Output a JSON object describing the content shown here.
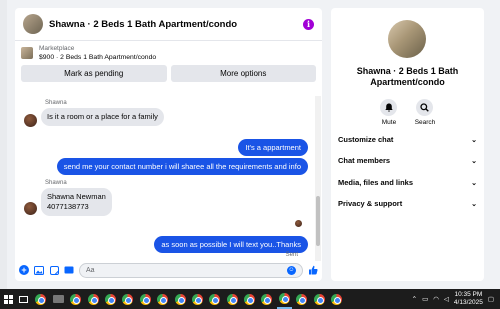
{
  "chat": {
    "title": "Shawna · 2 Beds 1 Bath Apartment/condo",
    "listing_label": "Marketplace",
    "listing_title": "$900 · 2 Beds 1 Bath Apartment/condo",
    "mark_pending": "Mark as pending",
    "more_options": "More options",
    "messages": [
      {
        "sender": "Shawna",
        "text": "Is it a room or a place for a family",
        "dir": "in"
      },
      {
        "text": "It's a appartment",
        "dir": "out"
      },
      {
        "text": "send me your contact number i will sharee  all the requirements and info",
        "dir": "out"
      },
      {
        "sender": "Shawna",
        "text": "Shawna Newman\n4077138773",
        "dir": "in"
      },
      {
        "text": "as soon as possible I will text you..Thanks",
        "dir": "out"
      }
    ],
    "sent_status": "Sent",
    "input_placeholder": "Aa",
    "accent": "#1a54e6"
  },
  "info": {
    "name": "Shawna · 2 Beds 1 Bath Apartment/condo",
    "mute_label": "Mute",
    "search_label": "Search",
    "sections": [
      "Customize chat",
      "Chat members",
      "Media, files and links",
      "Privacy & support"
    ]
  },
  "taskbar": {
    "time": "10:35 PM",
    "date": "4/13/2025"
  }
}
